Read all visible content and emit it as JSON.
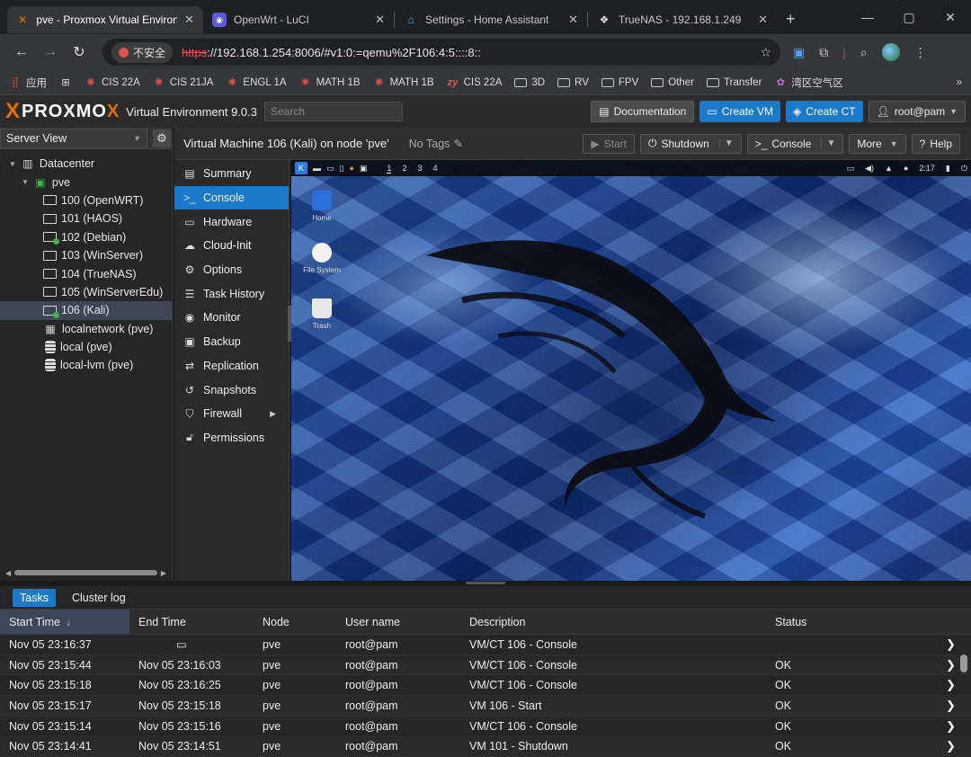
{
  "browser": {
    "tabs": [
      {
        "title": "pve - Proxmox Virtual Environme",
        "active": true
      },
      {
        "title": "OpenWrt - LuCI",
        "active": false
      },
      {
        "title": "Settings - Home Assistant",
        "active": false
      },
      {
        "title": "TrueNAS - 192.168.1.249",
        "active": false
      }
    ],
    "security_label": "不安全",
    "url_scheme": "https",
    "url_rest": "://192.168.1.254:8006/#v1:0:=qemu%2F106:4:5::::8::",
    "bookmarks": [
      {
        "label": "应用",
        "icon": "apps-icon"
      },
      {
        "label": "",
        "icon": "grid-icon"
      },
      {
        "label": "CIS 22A",
        "icon": "canvas-icon"
      },
      {
        "label": "CIS 21JA",
        "icon": "canvas-icon"
      },
      {
        "label": "ENGL 1A",
        "icon": "canvas-icon"
      },
      {
        "label": "MATH 1B",
        "icon": "canvas-icon"
      },
      {
        "label": "MATH 1B",
        "icon": "canvas-icon"
      },
      {
        "label": "CIS 22A",
        "icon": "zybooks-icon"
      },
      {
        "label": "3D",
        "icon": "folder-icon"
      },
      {
        "label": "RV",
        "icon": "folder-icon"
      },
      {
        "label": "FPV",
        "icon": "folder-icon"
      },
      {
        "label": "Other",
        "icon": "folder-icon"
      },
      {
        "label": "Transfer",
        "icon": "folder-icon"
      },
      {
        "label": "湾区空气区",
        "icon": "air-icon"
      }
    ]
  },
  "header": {
    "version": "Virtual Environment 9.0.3",
    "search_placeholder": "Search",
    "documentation": "Documentation",
    "create_vm": "Create VM",
    "create_ct": "Create CT",
    "user": "root@pam"
  },
  "sidebar": {
    "view": "Server View",
    "datacenter": "Datacenter",
    "node": "pve",
    "items": [
      {
        "label": "100 (OpenWRT)",
        "type": "vm"
      },
      {
        "label": "101 (HAOS)",
        "type": "vm"
      },
      {
        "label": "102 (Debian)",
        "type": "vm-running"
      },
      {
        "label": "103 (WinServer)",
        "type": "vm"
      },
      {
        "label": "104 (TrueNAS)",
        "type": "vm"
      },
      {
        "label": "105 (WinServerEdu)",
        "type": "vm"
      },
      {
        "label": "106 (Kali)",
        "type": "vm-running"
      },
      {
        "label": "localnetwork (pve)",
        "type": "network"
      },
      {
        "label": "local (pve)",
        "type": "storage"
      },
      {
        "label": "local-lvm (pve)",
        "type": "storage"
      }
    ]
  },
  "content": {
    "title": "Virtual Machine 106 (Kali) on node 'pve'",
    "no_tags": "No Tags",
    "start": "Start",
    "shutdown": "Shutdown",
    "console": "Console",
    "more": "More",
    "help": "Help"
  },
  "submenu": [
    {
      "label": "Summary",
      "icon": "summary-icon"
    },
    {
      "label": "Console",
      "icon": "terminal-icon"
    },
    {
      "label": "Hardware",
      "icon": "monitor-icon"
    },
    {
      "label": "Cloud-Init",
      "icon": "cloud-icon"
    },
    {
      "label": "Options",
      "icon": "gear-icon"
    },
    {
      "label": "Task History",
      "icon": "list-icon"
    },
    {
      "label": "Monitor",
      "icon": "eye-icon"
    },
    {
      "label": "Backup",
      "icon": "save-icon"
    },
    {
      "label": "Replication",
      "icon": "retweet-icon"
    },
    {
      "label": "Snapshots",
      "icon": "history-icon"
    },
    {
      "label": "Firewall",
      "icon": "shield-icon"
    },
    {
      "label": "Permissions",
      "icon": "unlock-icon"
    }
  ],
  "kali": {
    "workspaces": [
      "1",
      "2",
      "3",
      "4"
    ],
    "clock": "2:17",
    "desktop_icons": [
      "Home",
      "File System",
      "Trash"
    ]
  },
  "tasks": {
    "tabs": [
      "Tasks",
      "Cluster log"
    ],
    "columns": [
      "Start Time",
      "End Time",
      "Node",
      "User name",
      "Description",
      "Status"
    ],
    "rows": [
      {
        "start": "Nov 05 23:16:37",
        "end": "",
        "node": "pve",
        "user": "root@pam",
        "desc": "VM/CT 106 - Console",
        "status": ""
      },
      {
        "start": "Nov 05 23:15:44",
        "end": "Nov 05 23:16:03",
        "node": "pve",
        "user": "root@pam",
        "desc": "VM/CT 106 - Console",
        "status": "OK"
      },
      {
        "start": "Nov 05 23:15:18",
        "end": "Nov 05 23:16:25",
        "node": "pve",
        "user": "root@pam",
        "desc": "VM/CT 106 - Console",
        "status": "OK"
      },
      {
        "start": "Nov 05 23:15:17",
        "end": "Nov 05 23:15:18",
        "node": "pve",
        "user": "root@pam",
        "desc": "VM 106 - Start",
        "status": "OK"
      },
      {
        "start": "Nov 05 23:15:14",
        "end": "Nov 05 23:15:16",
        "node": "pve",
        "user": "root@pam",
        "desc": "VM/CT 106 - Console",
        "status": "OK"
      },
      {
        "start": "Nov 05 23:14:41",
        "end": "Nov 05 23:14:51",
        "node": "pve",
        "user": "root@pam",
        "desc": "VM 101 - Shutdown",
        "status": "OK"
      }
    ]
  },
  "colors": {
    "accent": "#1b79c9",
    "logo_orange": "#e57000",
    "running": "#39b54a"
  }
}
